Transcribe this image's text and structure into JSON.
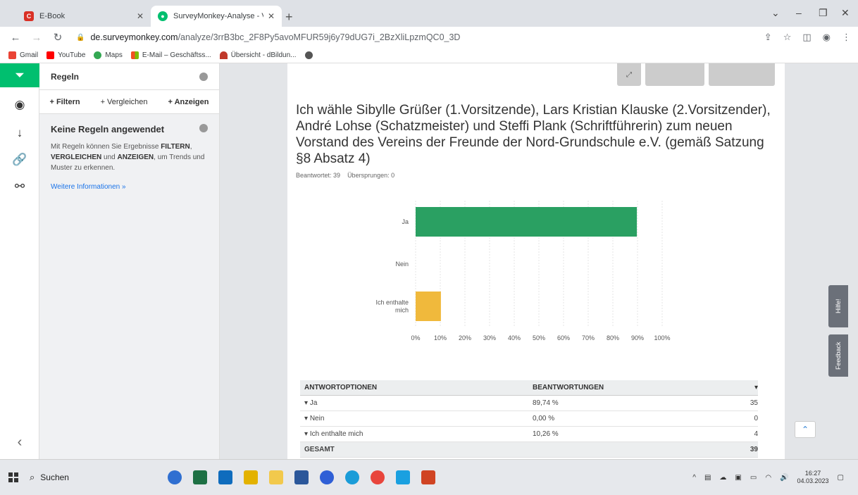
{
  "browser": {
    "tabs": [
      {
        "title": "E-Book",
        "active": false
      },
      {
        "title": "SurveyMonkey-Analyse - Vorstar",
        "active": true
      }
    ],
    "url_host": "de.surveymonkey.com",
    "url_path": "/analyze/3rrB3bc_2F8Py5avoMFUR59j6y79dUG7i_2BzXliLpzmQC0_3D",
    "bookmarks": [
      "Gmail",
      "YouTube",
      "Maps",
      "E-Mail – Geschäftss...",
      "Übersicht - dBildun..."
    ]
  },
  "rules_panel": {
    "title": "Regeln",
    "actions": [
      "+ Filtern",
      "+ Vergleichen",
      "+ Anzeigen"
    ],
    "none_title": "Keine Regeln angewendet",
    "desc_part1": "Mit Regeln können Sie Ergebnisse ",
    "desc_filter": "FILTERN",
    "desc_part2": ", ",
    "desc_compare": "VERGLEICHEN",
    "desc_part3": " und ",
    "desc_show": "ANZEIGEN",
    "desc_part4": ", um Trends und Muster zu erkennen.",
    "more_link": "Weitere Informationen »"
  },
  "question": {
    "title": "Ich wähle Sibylle Grüßer (1.Vorsitzende), Lars Kristian Klauske (2.Vorsitzender), André Lohse (Schatzmeister) und Steffi Plank (Schriftführerin) zum neuen Vorstand des Vereins der Freunde der Nord-Grundschule e.V. (gemäß Satzung §8 Absatz 4)",
    "answered_label": "Beantwortet: 39",
    "skipped_label": "Übersprungen: 0"
  },
  "chart_data": {
    "type": "bar",
    "orientation": "horizontal",
    "categories": [
      "Ja",
      "Nein",
      "Ich enthalte mich"
    ],
    "values": [
      89.74,
      0.0,
      10.26
    ],
    "xlim": [
      0,
      100
    ],
    "xticks": [
      "0%",
      "10%",
      "20%",
      "30%",
      "40%",
      "50%",
      "60%",
      "70%",
      "80%",
      "90%",
      "100%"
    ],
    "colors": [
      "#2aa062",
      "#2aa062",
      "#f0b93c"
    ],
    "grid": true
  },
  "table": {
    "headers": [
      "ANTWORTOPTIONEN",
      "BEANTWORTUNGEN",
      ""
    ],
    "rows": [
      {
        "option": "Ja",
        "percent": "89,74 %",
        "count": "35"
      },
      {
        "option": "Nein",
        "percent": "0,00 %",
        "count": "0"
      },
      {
        "option": "Ich enthalte mich",
        "percent": "10,26 %",
        "count": "4"
      }
    ],
    "total_label": "GESAMT",
    "total_count": "39"
  },
  "side_tabs": {
    "help": "Hilfe!",
    "feedback": "Feedback"
  },
  "taskbar": {
    "search": "Suchen",
    "time": "16:27",
    "date": "04.03.2023"
  }
}
